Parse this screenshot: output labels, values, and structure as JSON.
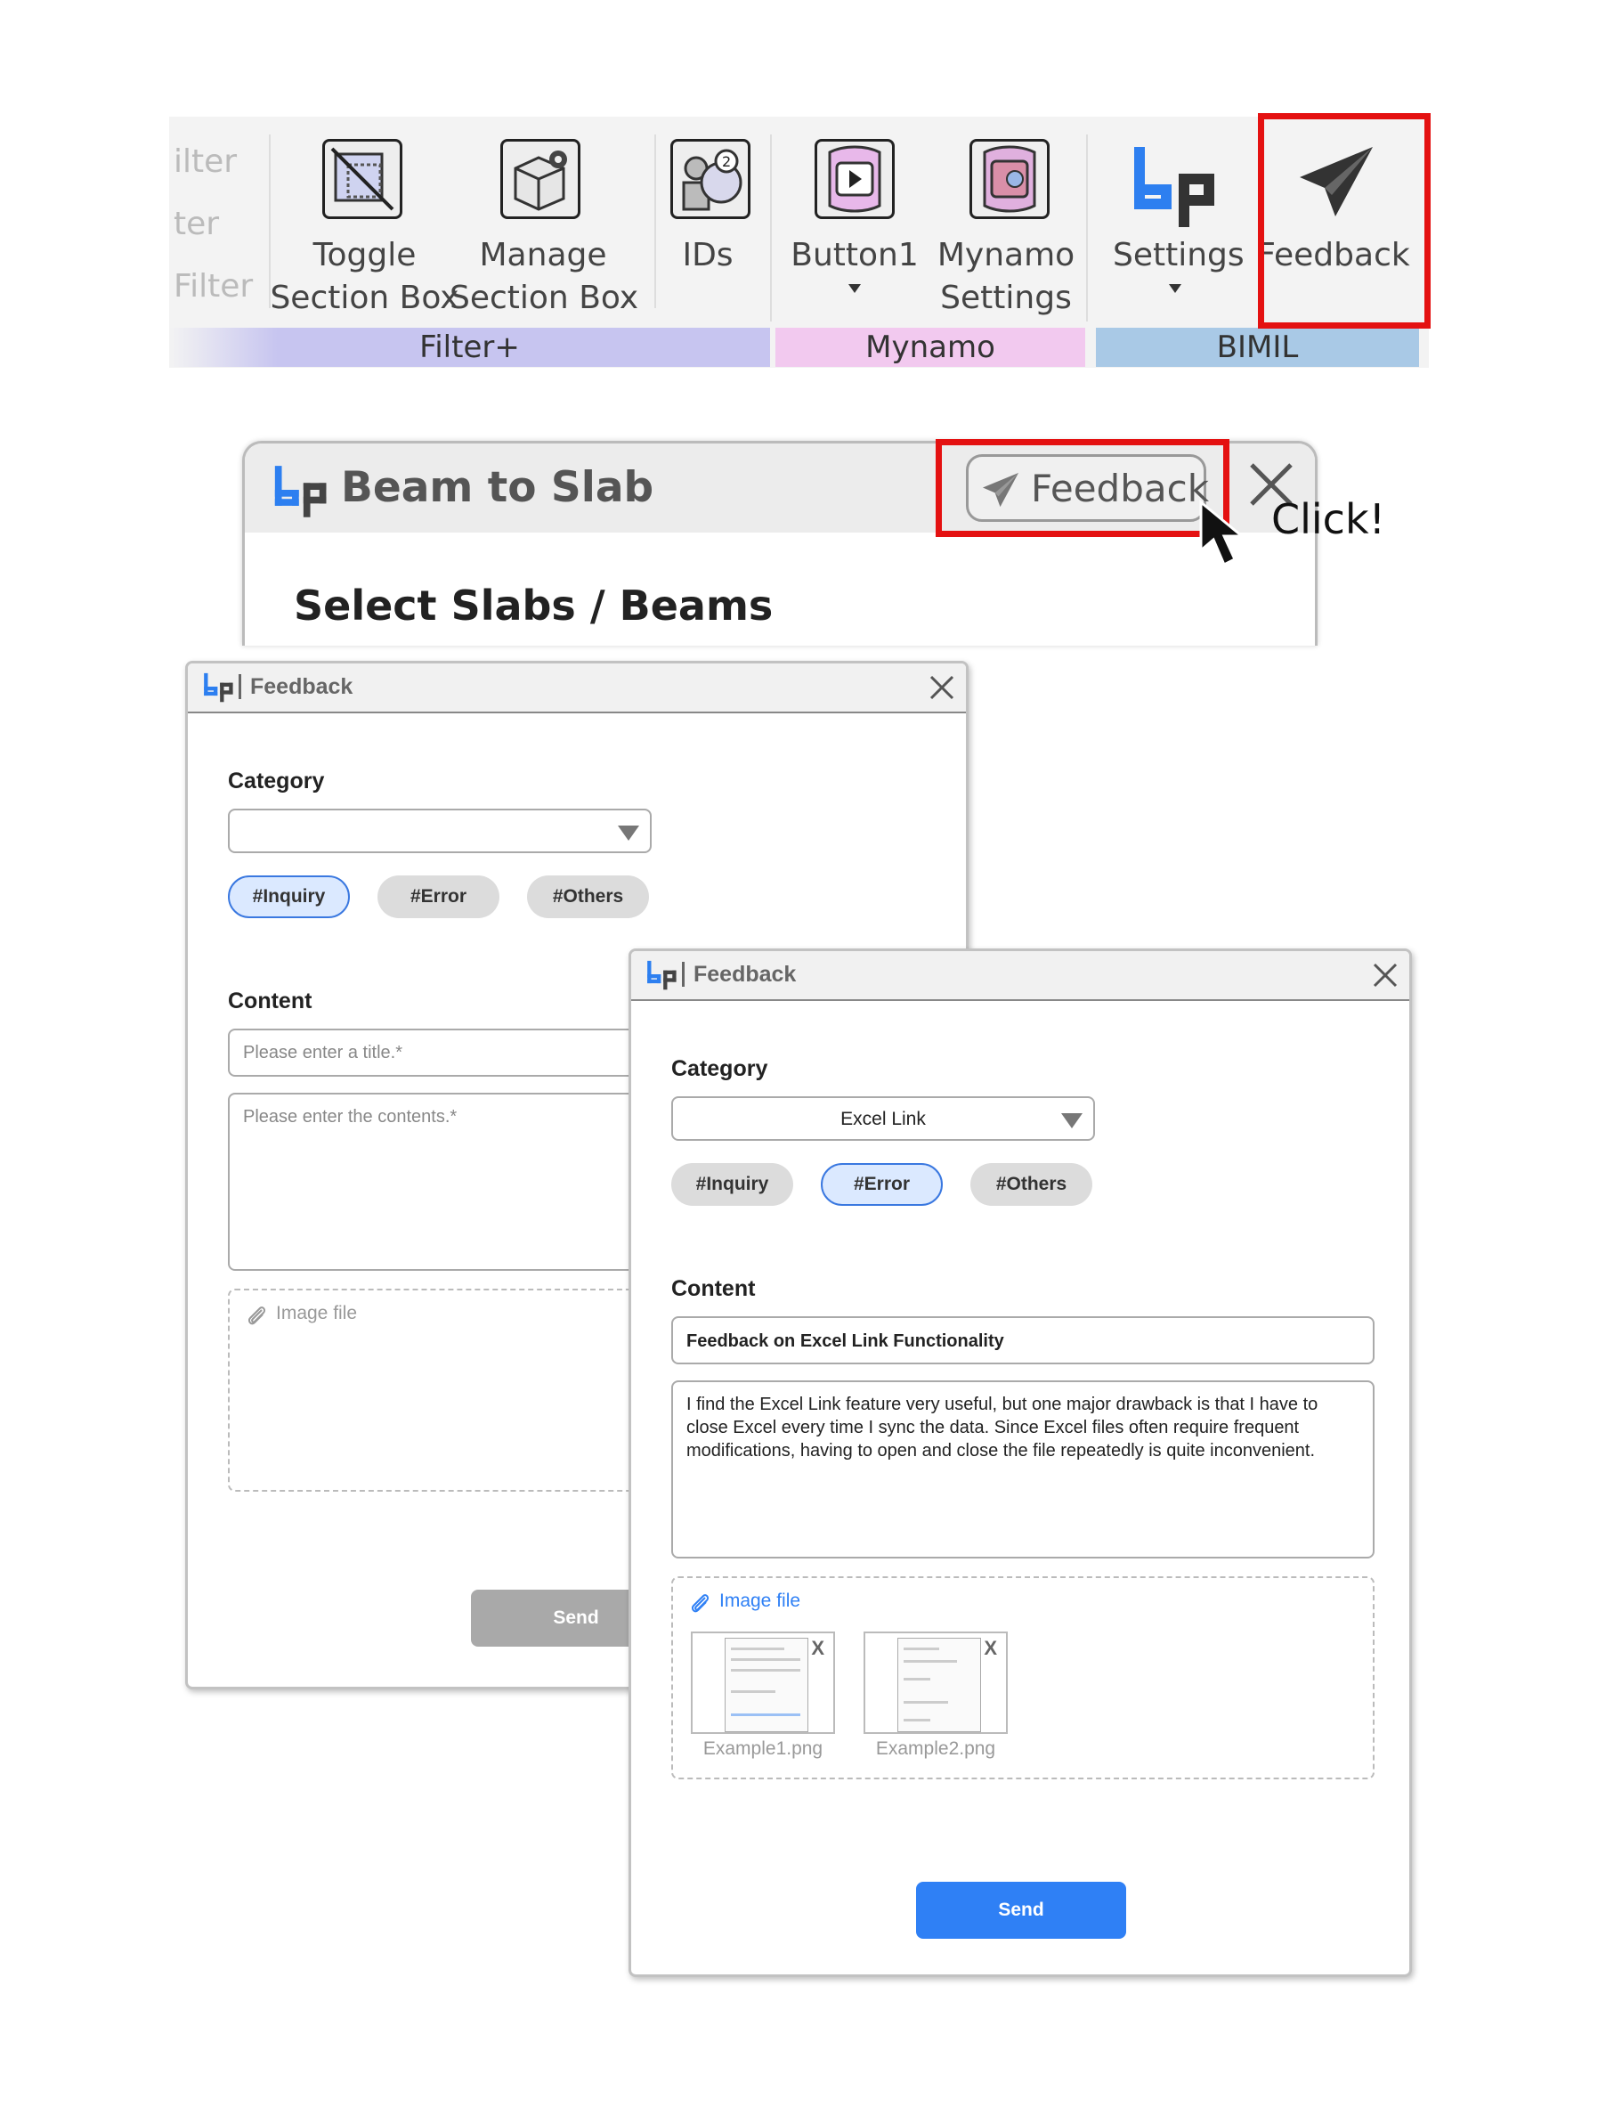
{
  "ribbon": {
    "faded_left": [
      "ilter",
      "ter",
      "Filter"
    ],
    "buttons": [
      {
        "line1": "Toggle",
        "line2": "Section Box"
      },
      {
        "line1": "Manage",
        "line2": "Section Box"
      },
      {
        "line1": "IDs",
        "line2": ""
      },
      {
        "line1": "Button1",
        "line2": ""
      },
      {
        "line1": "Mynamo",
        "line2": "Settings"
      },
      {
        "line1": "Settings",
        "line2": ""
      },
      {
        "line1": "Feedback",
        "line2": ""
      }
    ],
    "groups": [
      {
        "label": "Filter+",
        "color": "#c7c5f0"
      },
      {
        "label": "Mynamo",
        "color": "#f2c9ef"
      },
      {
        "label": "BIMIL",
        "color": "#a9c9e6"
      }
    ]
  },
  "beam_to_slab": {
    "title": "Beam to Slab",
    "feedback_label": "Feedback",
    "subtitle": "Select Slabs / Beams",
    "click_annotation": "Click!"
  },
  "dialog_empty": {
    "title": "Feedback",
    "category_label": "Category",
    "category_value": "",
    "chips": [
      "#Inquiry",
      "#Error",
      "#Others"
    ],
    "selected_chip": "#Inquiry",
    "content_label": "Content",
    "title_placeholder": "Please enter a title.*",
    "contents_placeholder": "Please enter the contents.*",
    "image_file_label": "Image file",
    "send_label": "Send"
  },
  "dialog_filled": {
    "title": "Feedback",
    "category_label": "Category",
    "category_value": "Excel Link",
    "chips": [
      "#Inquiry",
      "#Error",
      "#Others"
    ],
    "selected_chip": "#Error",
    "content_label": "Content",
    "title_value": "Feedback on Excel Link Functionality",
    "contents_value": "I find the Excel Link feature very useful, but one major drawback is that I have to close Excel every time I sync the data. Since Excel files often require frequent modifications, having to open and close the file repeatedly is quite inconvenient.",
    "image_file_label": "Image file",
    "attachments": [
      {
        "name": "Example1.png",
        "remove": "X"
      },
      {
        "name": "Example2.png",
        "remove": "X"
      }
    ],
    "send_label": "Send"
  },
  "colors": {
    "highlight_red": "#e41111",
    "accent_blue": "#2f80f5",
    "logo_blue": "#2d7ff0",
    "disabled_gray": "#a9a9a9"
  }
}
